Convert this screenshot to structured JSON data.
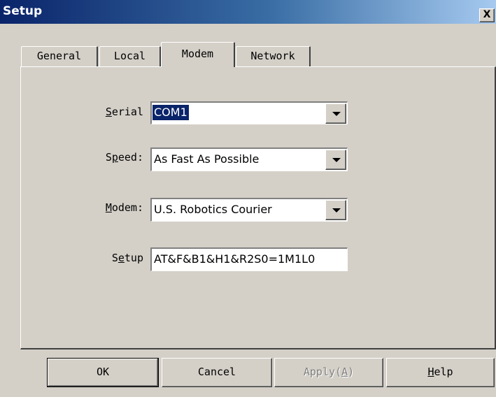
{
  "window": {
    "title": "Setup",
    "close_symbol": "X"
  },
  "tabs": [
    {
      "label": "General",
      "active": false
    },
    {
      "label": "Local",
      "active": false
    },
    {
      "label": "Modem",
      "active": true
    },
    {
      "label": "Network",
      "active": false
    }
  ],
  "form": {
    "serial": {
      "label": "Serial",
      "mnemonic": "S",
      "rest": "erial",
      "value": "COM1"
    },
    "speed": {
      "label": "Speed:",
      "pre": "S",
      "mnemonic": "p",
      "rest": "eed:",
      "value": "As Fast As Possible"
    },
    "modem": {
      "label": "Modem:",
      "mnemonic": "M",
      "rest": "odem:",
      "value": "U.S. Robotics Courier"
    },
    "setup": {
      "label": "Setup",
      "pre": "S",
      "mnemonic": "e",
      "rest": "tup",
      "value": "AT&F&B1&H1&R2S0=1M1L0"
    }
  },
  "buttons": {
    "ok": "OK",
    "cancel": "Cancel",
    "apply_pre": "Apply(",
    "apply_mnemonic": "A",
    "apply_post": ")",
    "help_mnemonic": "H",
    "help_rest": "elp"
  }
}
